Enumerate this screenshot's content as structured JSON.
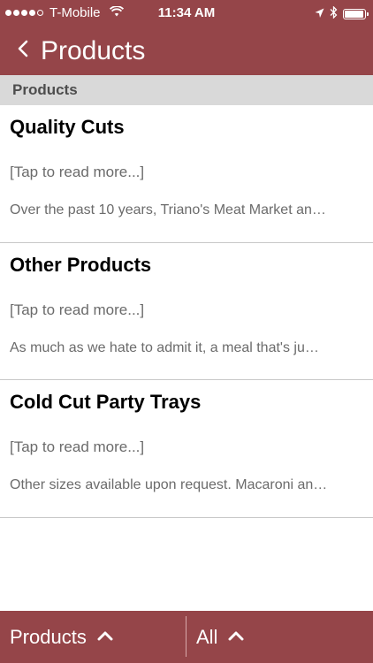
{
  "status_bar": {
    "carrier": "T-Mobile",
    "time": "11:34 AM",
    "signal_bars": 4,
    "battery_level": 0.95
  },
  "nav": {
    "title": "Products",
    "back_icon": "chevron-left-icon"
  },
  "section": {
    "header": "Products"
  },
  "items": [
    {
      "title": "Quality Cuts",
      "tap": "[Tap to read more...]",
      "description": "Over the past 10 years, Triano's Meat Market an…"
    },
    {
      "title": "Other Products",
      "tap": "[Tap to read more...]",
      "description": "As much as we hate to admit it, a meal that's ju…"
    },
    {
      "title": "Cold Cut Party Trays",
      "tap": "[Tap to read more...]",
      "description": "Other sizes available upon request. Macaroni an…"
    }
  ],
  "tab_bar": {
    "left_label": "Products",
    "right_label": "All",
    "icon": "chevron-up-icon"
  },
  "colors": {
    "brand": "#954549",
    "section_header_bg": "#d9d9d9",
    "divider": "#c8c8c8"
  }
}
